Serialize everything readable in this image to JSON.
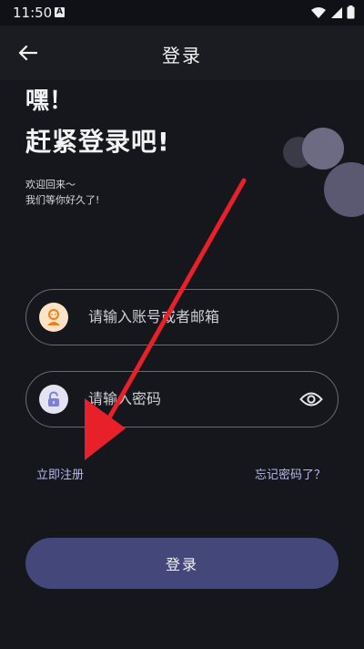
{
  "status_bar": {
    "time": "11:50",
    "notification_badge": "A",
    "icons": [
      "wifi-icon",
      "signal-icon",
      "battery-icon"
    ]
  },
  "header": {
    "title": "登录",
    "back_icon": "arrow-left-icon"
  },
  "greeting": {
    "line1": "嘿！",
    "line2": "赶紧登录吧!",
    "sub1": "欢迎回来～",
    "sub2": "我们等你好久了!"
  },
  "form": {
    "account_placeholder": "请输入账号或者邮箱",
    "password_placeholder": "请输入密码",
    "account_icon": "user-avatar-icon",
    "password_icon": "lock-icon",
    "toggle_icon": "eye-icon"
  },
  "links": {
    "register": "立即注册",
    "forgot": "忘记密码了？"
  },
  "login_button": "登录",
  "colors": {
    "background": "#16171c",
    "accent": "#44477a",
    "link": "#b7b8ec",
    "annotation_arrow": "#e8202a"
  }
}
